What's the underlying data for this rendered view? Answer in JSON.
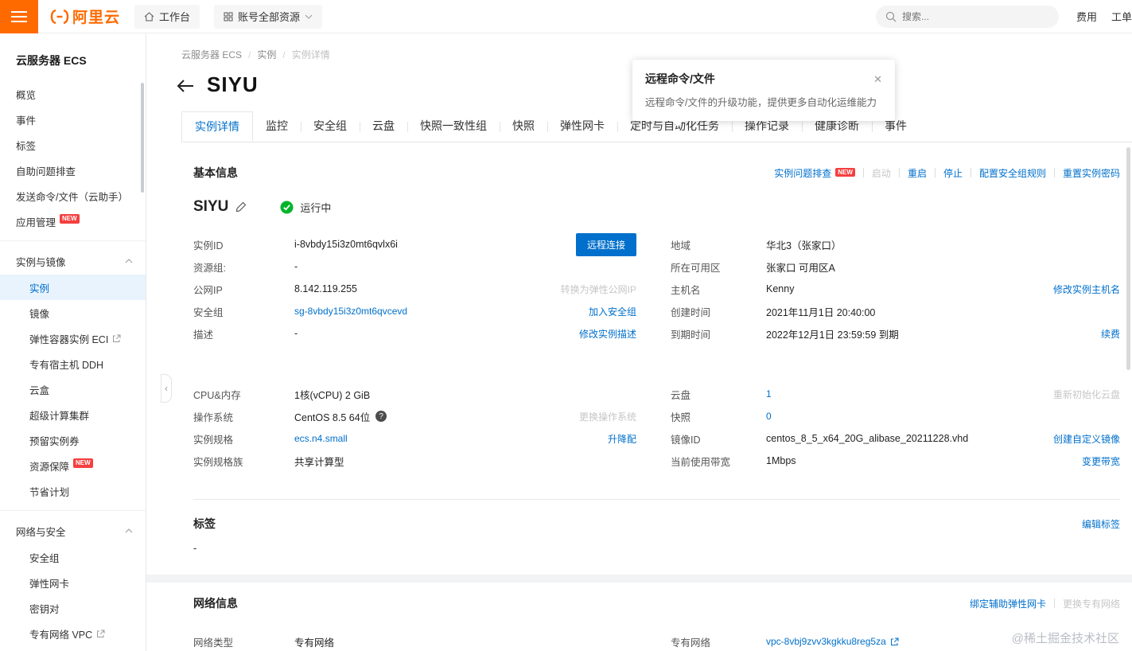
{
  "colors": {
    "accent": "#0070cc",
    "brand_orange": "#ff6a00",
    "status_green": "#00b42a",
    "badge_red": "#f53f3f"
  },
  "topbar": {
    "logo_text": "阿里云",
    "workbench": "工作台",
    "account_resources": "账号全部资源",
    "search_placeholder": "搜索...",
    "billing": "费用",
    "ticket": "工单"
  },
  "sidebar": {
    "title": "云服务器 ECS",
    "items": [
      "概览",
      "事件",
      "标签",
      "自助问题排查",
      "发送命令/文件（云助手）",
      "应用管理"
    ],
    "app_badge": "NEW",
    "section1": {
      "title": "实例与镜像",
      "items": [
        "实例",
        "镜像",
        "弹性容器实例 ECI",
        "专有宿主机 DDH",
        "云盒",
        "超级计算集群",
        "预留实例券",
        "资源保障",
        "节省计划"
      ],
      "resource_badge": "NEW"
    },
    "section2": {
      "title": "网络与安全",
      "items": [
        "安全组",
        "弹性网卡",
        "密钥对",
        "专有网络 VPC"
      ]
    }
  },
  "breadcrumb": {
    "items": [
      "云服务器 ECS",
      "实例",
      "实例详情"
    ],
    "sep": "/"
  },
  "page": {
    "title": "SIYU",
    "status": "运行中"
  },
  "tooltip": {
    "title": "远程命令/文件",
    "body": "远程命令/文件的升级功能，提供更多自动化运维能力",
    "close": "✕"
  },
  "tabs": [
    "实例详情",
    "监控",
    "安全组",
    "云盘",
    "快照一致性组",
    "快照",
    "弹性网卡",
    "定时与自动化任务",
    "操作记录",
    "健康诊断",
    "事件"
  ],
  "basic": {
    "header": "基本信息",
    "actions": {
      "troubleshoot": "实例问题排查",
      "troubleshoot_badge": "NEW",
      "start": "启动",
      "reboot": "重启",
      "stop": "停止",
      "configure_sg": "配置安全组规则",
      "reset_password": "重置实例密码"
    },
    "remote_button": "远程连接",
    "left1": [
      {
        "label": "实例ID",
        "value": "i-8vbdy15i3z0mt6qvlx6i"
      },
      {
        "label": "资源组:",
        "value": "-"
      },
      {
        "label": "公网IP",
        "value": "8.142.119.255",
        "action": "转换为弹性公网IP"
      },
      {
        "label": "安全组",
        "value": "sg-8vbdy15i3z0mt6qvcevd",
        "action": "加入安全组"
      },
      {
        "label": "描述",
        "value": "-",
        "action": "修改实例描述"
      }
    ],
    "right1": [
      {
        "label": "地域",
        "value": "华北3（张家口）"
      },
      {
        "label": "所在可用区",
        "value": "张家口 可用区A"
      },
      {
        "label": "主机名",
        "value": "Kenny",
        "action": "修改实例主机名"
      },
      {
        "label": "创建时间",
        "value": "2021年11月1日 20:40:00"
      },
      {
        "label": "到期时间",
        "value": "2022年12月1日 23:59:59 到期",
        "action": "续费"
      }
    ],
    "left2": [
      {
        "label": "CPU&内存",
        "value": "1核(vCPU) 2 GiB"
      },
      {
        "label": "操作系统",
        "value": "CentOS 8.5 64位",
        "action": "更换操作系统"
      },
      {
        "label": "实例规格",
        "value": "ecs.n4.small",
        "action": "升降配"
      },
      {
        "label": "实例规格族",
        "value": "共享计算型"
      }
    ],
    "right2": [
      {
        "label": "云盘",
        "value": "1",
        "action": "重新初始化云盘"
      },
      {
        "label": "快照",
        "value": "0"
      },
      {
        "label": "镜像ID",
        "value": "centos_8_5_x64_20G_alibase_20211228.vhd",
        "action": "创建自定义镜像"
      },
      {
        "label": "当前使用带宽",
        "value": "1Mbps",
        "action": "变更带宽"
      }
    ]
  },
  "tags": {
    "header": "标签",
    "action": "编辑标签",
    "value": "-"
  },
  "network": {
    "header": "网络信息",
    "actions": [
      "绑定辅助弹性网卡",
      "更换专有网络"
    ],
    "left": {
      "label": "网络类型",
      "value": "专有网络"
    },
    "right": {
      "label": "专有网络",
      "value": "vpc-8vbj9zvv3kgkku8reg5za"
    }
  },
  "icons": {
    "question": "?",
    "collapse": "‹"
  },
  "watermark": "@稀土掘金技术社区"
}
